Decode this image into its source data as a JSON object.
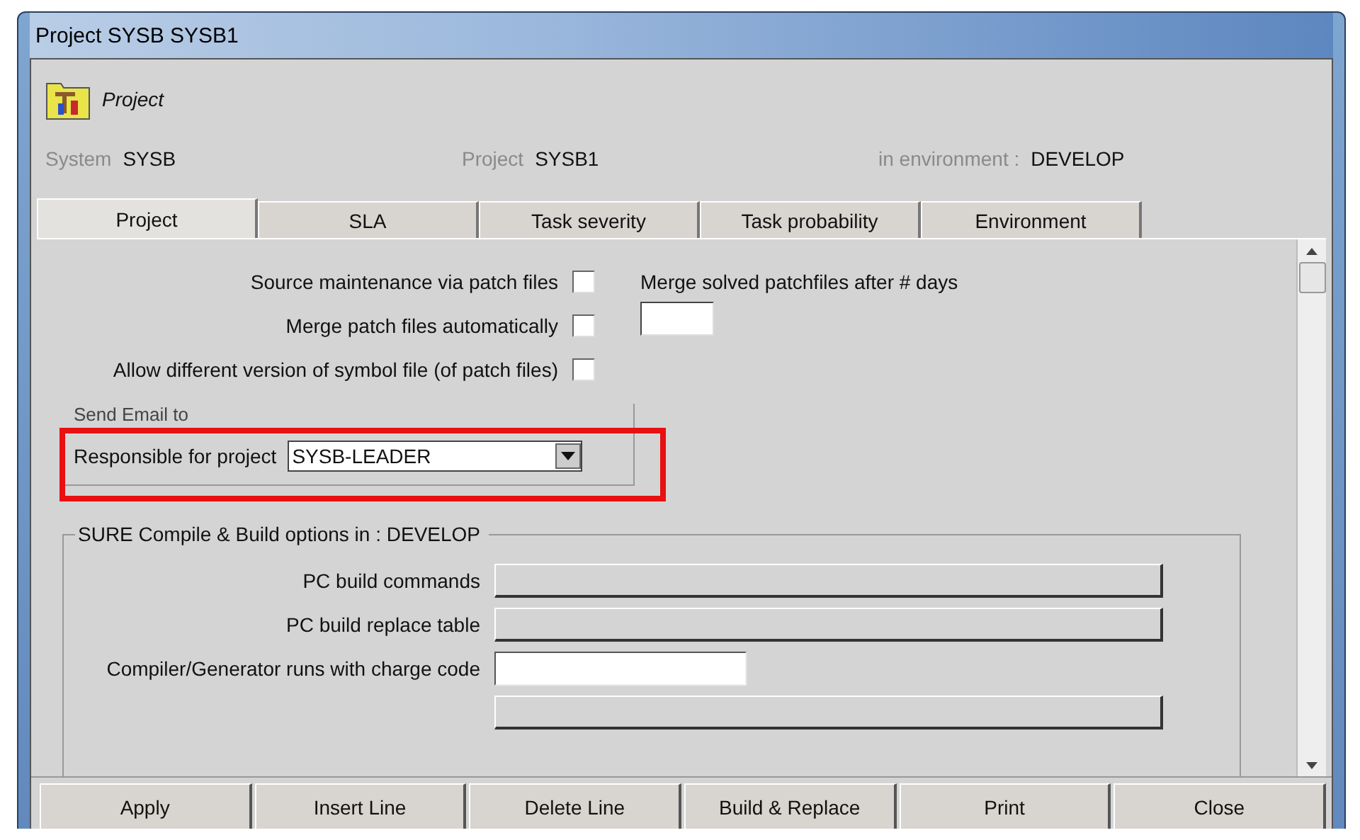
{
  "window": {
    "title": "Project SYSB SYSB1"
  },
  "header": {
    "caption": "Project",
    "fields": [
      {
        "label": "System",
        "value": "SYSB"
      },
      {
        "label": "Project",
        "value": "SYSB1"
      },
      {
        "label": "in environment :",
        "value": "DEVELOP"
      }
    ]
  },
  "tabs": [
    {
      "label": "Project",
      "selected": true
    },
    {
      "label": "SLA",
      "selected": false
    },
    {
      "label": "Task severity",
      "selected": false
    },
    {
      "label": "Task probability",
      "selected": false
    },
    {
      "label": "Environment",
      "selected": false
    }
  ],
  "options": [
    {
      "label": "Source maintenance via patch files",
      "checked": false
    },
    {
      "label": "Merge patch files automatically",
      "checked": false
    },
    {
      "label": "Allow different version of symbol file (of patch files)",
      "checked": false
    }
  ],
  "merge_days": {
    "label": "Merge solved patchfiles after # days"
  },
  "send_email": {
    "title": "Send Email to",
    "label": "Responsible for project",
    "value": "SYSB-LEADER"
  },
  "build_options": {
    "title": "SURE Compile & Build options in : DEVELOP",
    "rows": [
      {
        "kind": "button",
        "label": "PC build commands"
      },
      {
        "kind": "button",
        "label": "PC build replace table"
      },
      {
        "kind": "input",
        "label": "Compiler/Generator runs with charge code"
      },
      {
        "kind": "button",
        "label": ""
      }
    ]
  },
  "buttons": [
    "Apply",
    "Insert Line",
    "Delete Line",
    "Build & Replace",
    "Print",
    "Close"
  ]
}
